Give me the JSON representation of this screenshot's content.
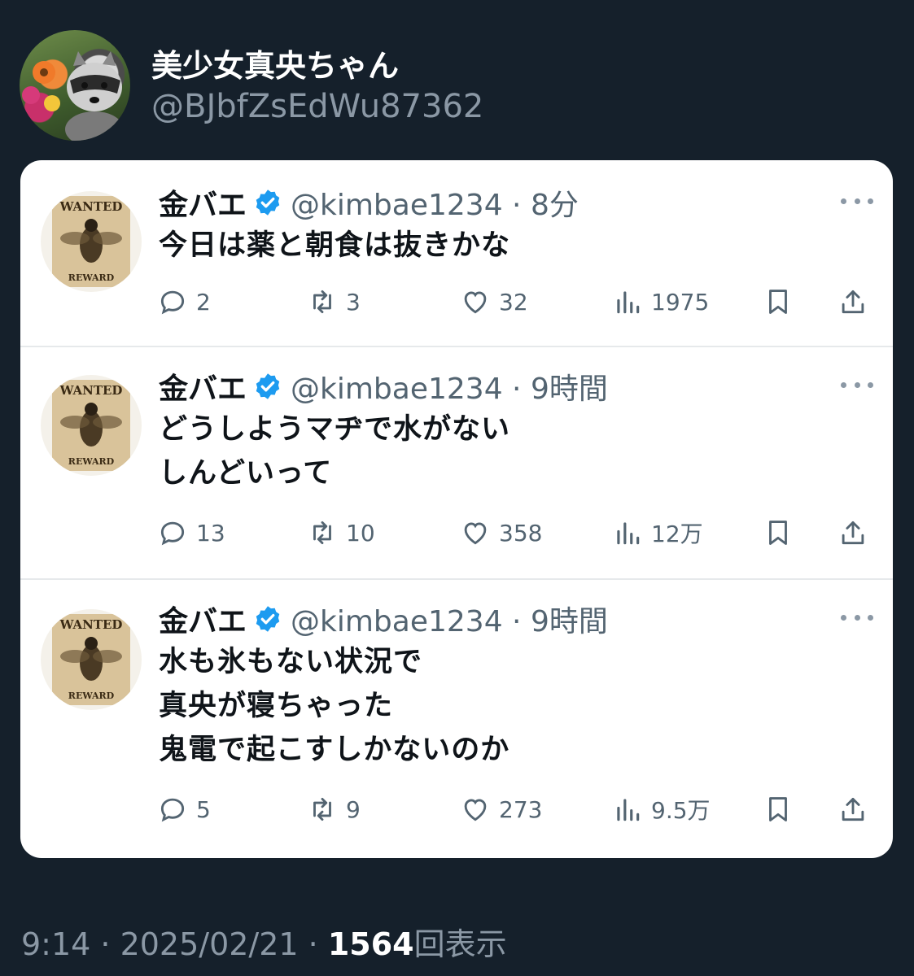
{
  "author": {
    "name": "美少女真央ちゃん",
    "handle": "@BJbfZsEdWu87362"
  },
  "quoted_tweets": [
    {
      "name": "金バエ",
      "meta": "@kimbae1234 · 8分",
      "lines": [
        "今日は薬と朝食は抜きかな"
      ],
      "replies": "2",
      "retweets": "3",
      "likes": "32",
      "views": "1975"
    },
    {
      "name": "金バエ",
      "meta": "@kimbae1234 · 9時間",
      "lines": [
        "どうしようマヂで水がない",
        "しんどいって"
      ],
      "replies": "13",
      "retweets": "10",
      "likes": "358",
      "views": "12万"
    },
    {
      "name": "金バエ",
      "meta": "@kimbae1234 · 9時間",
      "lines": [
        "水も氷もない状況で",
        "真央が寝ちゃった",
        "鬼電で起こすしかないのか"
      ],
      "replies": "5",
      "retweets": "9",
      "likes": "273",
      "views": "9.5万"
    }
  ],
  "footer": {
    "time_date": "9:14 · 2025/02/21 · ",
    "view_count": "1564",
    "views_label": "回表示"
  },
  "avatar_text": {
    "wanted": "WANTED",
    "reward": "REWARD"
  },
  "colors": {
    "background": "#15202b",
    "card": "#ffffff",
    "verified": "#1d9bf0",
    "muted": "#536471"
  }
}
